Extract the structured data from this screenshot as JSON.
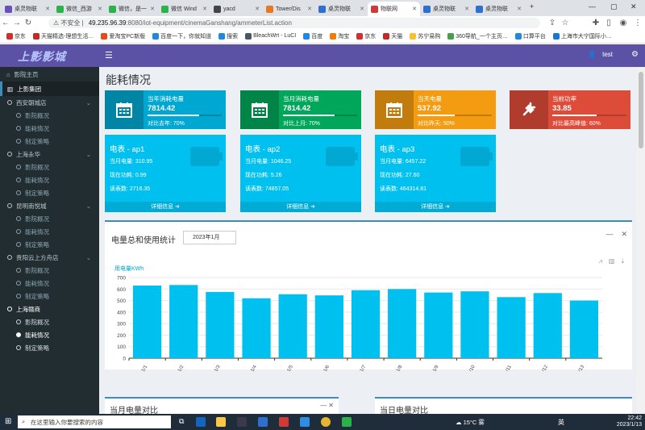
{
  "browser": {
    "tabs": [
      "桌灵物联",
      "微信_西游",
      "微信，是一",
      "微信 Wind",
      "yacd",
      "Tower/Dis",
      "桌灵物联",
      "物联网",
      "桌灵物联",
      "桌灵物联"
    ],
    "active_tab": 7,
    "url_warning": "不安全",
    "url_host": "49.235.96.39",
    "url_path": ":8080/iot-equipment/cinemaGanshang/ammeterList.action",
    "bookmarks": [
      "京东",
      "天猫精选-理想生活…",
      "爱淘宝PC新版",
      "百度一下，你就知道",
      "搜索",
      "BleachWrt - LuCI",
      "百度",
      "淘宝",
      "京东",
      "天猫",
      "苏宁易购",
      "360导航_一个主页…",
      "口算平台",
      "上海市大宁国际小…"
    ]
  },
  "app": {
    "logo": "上影影城",
    "user": "test"
  },
  "sidebar": {
    "home": "影院主页",
    "group": "上影集团",
    "cinemas": [
      {
        "name": "西安朝城店",
        "subs": [
          "影院概况",
          "能耗情况",
          "制定策略"
        ]
      },
      {
        "name": "上海永华",
        "subs": [
          "影院概况",
          "能耗情况",
          "制定策略"
        ]
      },
      {
        "name": "昆明南悦城",
        "subs": [
          "影院概况",
          "能耗情况",
          "制定策略"
        ]
      },
      {
        "name": "贵阳云上方舟店",
        "subs": [
          "影院概况",
          "能耗情况",
          "制定策略"
        ]
      },
      {
        "name": "上海赣商",
        "subs": [
          "影院概况",
          "能耗情况",
          "制定策略"
        ]
      }
    ],
    "active_sub": "能耗情况"
  },
  "page": {
    "title": "能耗情况",
    "info_boxes": [
      {
        "label": "当年消耗电量",
        "value": "7814.42",
        "sub": "对比去年:  70%",
        "progress": 0.7,
        "color": "#00a7d0",
        "icon": "calendar-icon"
      },
      {
        "label": "当月消耗电量",
        "value": "7814.42",
        "sub": "对比上月:  70%",
        "progress": 0.7,
        "color": "#00a65a",
        "icon": "calendar-icon"
      },
      {
        "label": "当天电量",
        "value": "537.92",
        "sub": "对比昨天:  50%",
        "progress": 0.5,
        "color": "#f39c12",
        "icon": "calendar-icon"
      },
      {
        "label": "当前功率",
        "value": "33.85",
        "sub": "对比最高峰值:  60%",
        "progress": 0.6,
        "color": "#dd4b39",
        "icon": "plug-icon"
      }
    ],
    "meters": [
      {
        "title": "电表 - ap1",
        "month_label": "当月电量: ",
        "month": "310.95",
        "power_label": "现在功耗: ",
        "power": "0.99",
        "read_label": "读表数: ",
        "read": "2716.35",
        "more": "详细信息 ➔"
      },
      {
        "title": "电表 - ap2",
        "month_label": "当月电量: ",
        "month": "1046.25",
        "power_label": "现在功耗: ",
        "power": "5.26",
        "read_label": "读表数: ",
        "read": "74857.05",
        "more": "详细信息 ➔"
      },
      {
        "title": "电表 - ap3",
        "month_label": "当月电量: ",
        "month": "6457.22",
        "power_label": "现在功耗: ",
        "power": "27.60",
        "read_label": "读表数: ",
        "read": "464314.81",
        "more": "详细信息 ➔"
      }
    ],
    "chart_panel": {
      "title": "电量总和使用统计",
      "date": "2023年1月",
      "min_icon": "minus-icon",
      "close_icon": "close-icon"
    },
    "bottom_panels": [
      "当月电量对比",
      "当日电量对比"
    ]
  },
  "chart_data": {
    "type": "bar",
    "ylabel": "用电量KWh",
    "categories": [
      "1/1",
      "1/2",
      "1/3",
      "1/4",
      "1/5",
      "1/6",
      "1/7",
      "1/8",
      "1/9",
      "1/10",
      "1/11",
      "1/12",
      "1/13"
    ],
    "values": [
      630,
      635,
      575,
      520,
      555,
      545,
      590,
      600,
      570,
      580,
      530,
      565,
      500
    ],
    "ylim": [
      0,
      700
    ],
    "yticks": [
      0,
      100,
      200,
      300,
      400,
      500,
      600,
      700
    ],
    "color": "#00c0ef",
    "grid": true
  },
  "taskbar": {
    "search_placeholder": "在这里输入你要搜索的内容",
    "weather": "15°C 雾",
    "ime": "英",
    "time": "22:42",
    "date": "2023/1/13"
  }
}
